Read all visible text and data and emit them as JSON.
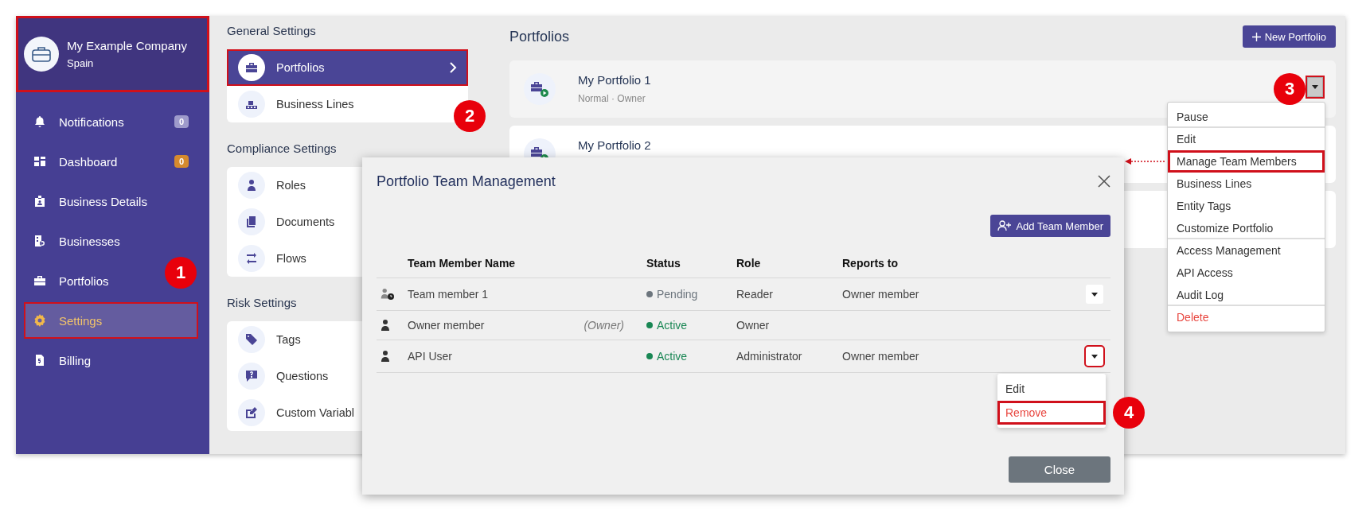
{
  "sidebar": {
    "company": {
      "name": "My Example Company",
      "subtitle": "Spain",
      "highlighted": true
    },
    "items": [
      {
        "label": "Notifications",
        "badge": {
          "text": "0",
          "color": "#9e9bcb"
        },
        "selected": false,
        "highlighted": false
      },
      {
        "label": "Dashboard",
        "badge": {
          "text": "0",
          "color": "#d68a2e"
        },
        "selected": false,
        "highlighted": false
      },
      {
        "label": "Business Details",
        "selected": false,
        "highlighted": false
      },
      {
        "label": "Businesses",
        "selected": false,
        "highlighted": false
      },
      {
        "label": "Portfolios",
        "selected": false,
        "highlighted": false
      },
      {
        "label": "Settings",
        "selected": true,
        "highlighted": true
      },
      {
        "label": "Billing",
        "selected": false,
        "highlighted": false
      }
    ]
  },
  "settings": {
    "groups": [
      {
        "title": "General Settings",
        "items": [
          {
            "label": "Portfolios",
            "selected": true,
            "highlighted": true
          },
          {
            "label": "Business Lines",
            "selected": false,
            "highlighted": false
          }
        ]
      },
      {
        "title": "Compliance Settings",
        "items": [
          {
            "label": "Roles",
            "selected": false,
            "highlighted": false
          },
          {
            "label": "Documents",
            "selected": false,
            "highlighted": false
          },
          {
            "label": "Flows",
            "selected": false,
            "highlighted": false
          }
        ]
      },
      {
        "title": "Risk Settings",
        "items": [
          {
            "label": "Tags",
            "selected": false,
            "highlighted": false
          },
          {
            "label": "Questions",
            "selected": false,
            "highlighted": false
          },
          {
            "label": "Custom Variabl",
            "selected": false,
            "highlighted": false
          }
        ]
      }
    ]
  },
  "portfolios": {
    "title": "Portfolios",
    "new_button": "New Portfolio",
    "cards": [
      {
        "name": "My Portfolio 1",
        "subtitle": "Normal · Owner",
        "menu_highlighted": true
      },
      {
        "name": "My Portfolio 2"
      }
    ],
    "menu": {
      "items": [
        {
          "label": "Pause",
          "divider_after": true,
          "danger": false,
          "highlighted": false
        },
        {
          "label": "Edit",
          "divider_after": false,
          "danger": false,
          "highlighted": false
        },
        {
          "label": "Manage Team Members",
          "divider_after": false,
          "danger": false,
          "highlighted": true
        },
        {
          "label": "Business Lines",
          "divider_after": false,
          "danger": false,
          "highlighted": false
        },
        {
          "label": "Entity Tags",
          "divider_after": false,
          "danger": false,
          "highlighted": false
        },
        {
          "label": "Customize Portfolio",
          "divider_after": true,
          "danger": false,
          "highlighted": false
        },
        {
          "label": "Access Management",
          "divider_after": false,
          "danger": false,
          "highlighted": false
        },
        {
          "label": "API Access",
          "divider_after": false,
          "danger": false,
          "highlighted": false
        },
        {
          "label": "Audit Log",
          "divider_after": true,
          "danger": false,
          "highlighted": false
        },
        {
          "label": "Delete",
          "divider_after": false,
          "danger": true,
          "highlighted": false
        }
      ]
    }
  },
  "modal": {
    "title": "Portfolio Team Management",
    "add_button": "Add Team Member",
    "columns": [
      "Team Member Name",
      "Status",
      "Role",
      "Reports to"
    ],
    "rows": [
      {
        "kind": "pending",
        "name": "Team member 1",
        "status": {
          "text": "Pending",
          "color": "#6c757d"
        },
        "role": "Reader",
        "reports_to": "Owner member",
        "actions": true,
        "action_highlighted": false
      },
      {
        "kind": "member",
        "name": "Owner member",
        "tag": "(Owner)",
        "status": {
          "text": "Active",
          "color": "#198754"
        },
        "role": "Owner"
      },
      {
        "kind": "member",
        "name": "API User",
        "status": {
          "text": "Active",
          "color": "#198754"
        },
        "role": "Administrator",
        "reports_to": "Owner member",
        "actions": true,
        "action_highlighted": true
      }
    ],
    "row_menu": {
      "items": [
        {
          "label": "Edit",
          "danger": false,
          "highlighted": false
        },
        {
          "label": "Remove",
          "danger": true,
          "highlighted": true
        }
      ]
    },
    "close_button": "Close"
  },
  "annotations": [
    "1",
    "2",
    "3",
    "4"
  ]
}
